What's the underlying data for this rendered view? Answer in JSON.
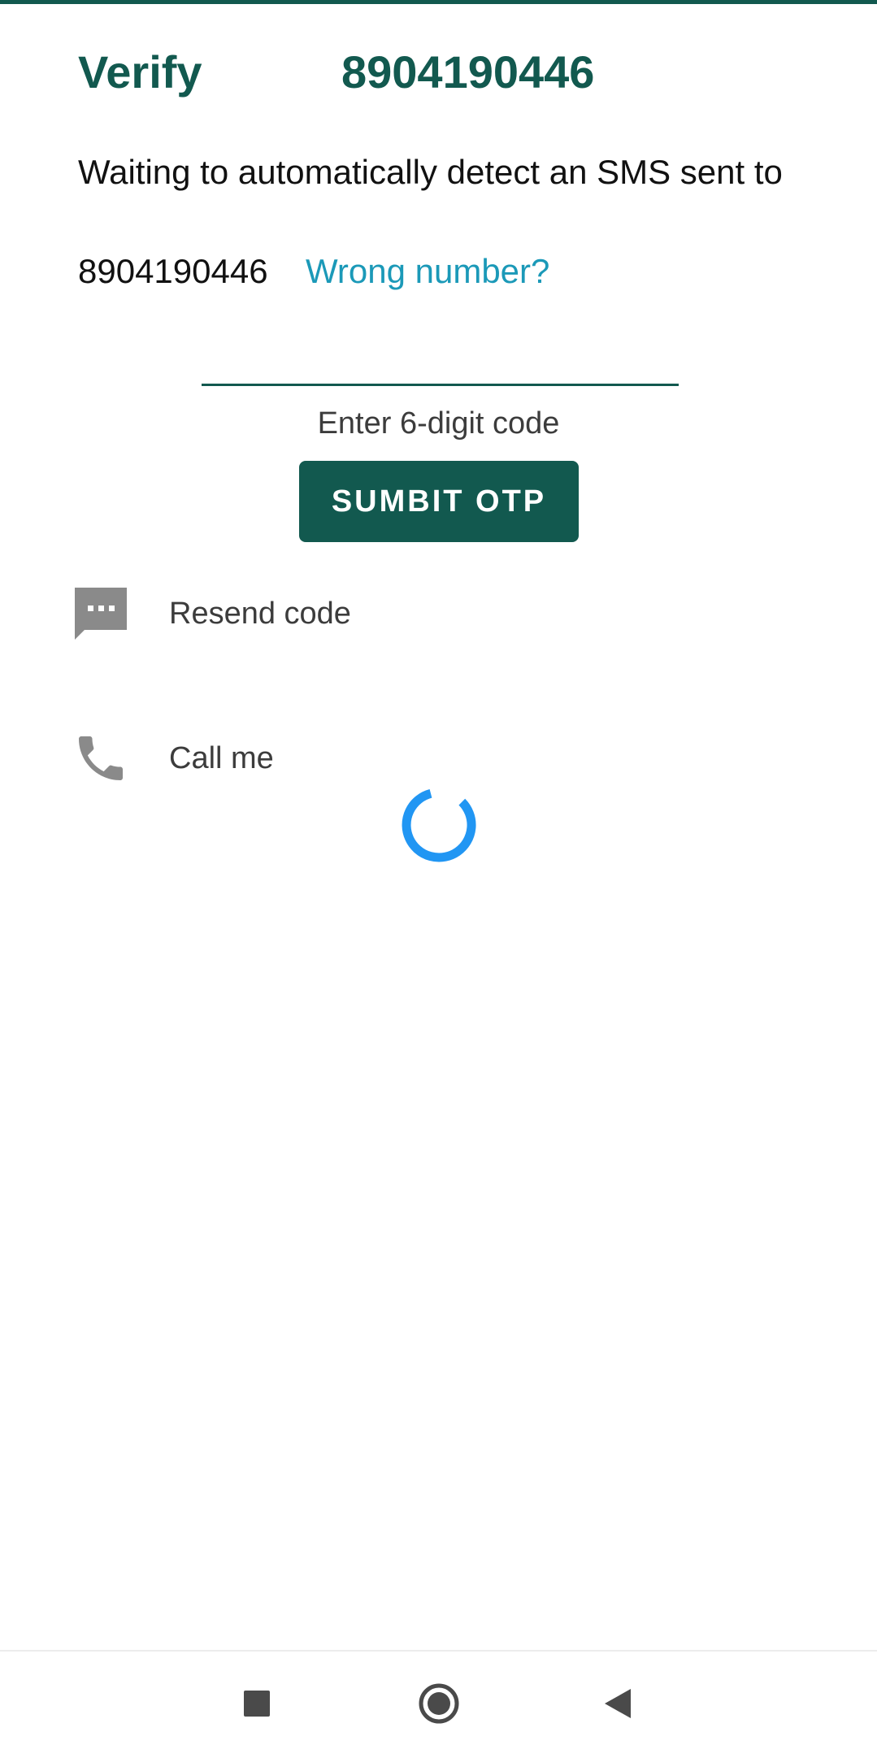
{
  "header": {
    "title": "Verify",
    "phone": "8904190446"
  },
  "message": {
    "waiting": "Waiting to automatically detect an SMS sent to",
    "phone": "8904190446",
    "wrong_number_link": "Wrong number?"
  },
  "otp": {
    "value": "",
    "hint": "Enter 6-digit code",
    "submit_label": "SUMBIT OTP"
  },
  "options": [
    {
      "label": "Resend code",
      "icon": "message-icon"
    },
    {
      "label": "Call me",
      "icon": "phone-icon"
    }
  ],
  "colors": {
    "primary": "#12594f",
    "link": "#1b99b8",
    "spinner": "#2196f3",
    "icon": "#8a8a8a"
  },
  "navbar": {
    "icons": [
      "recent-apps-icon",
      "home-icon",
      "back-icon"
    ]
  }
}
